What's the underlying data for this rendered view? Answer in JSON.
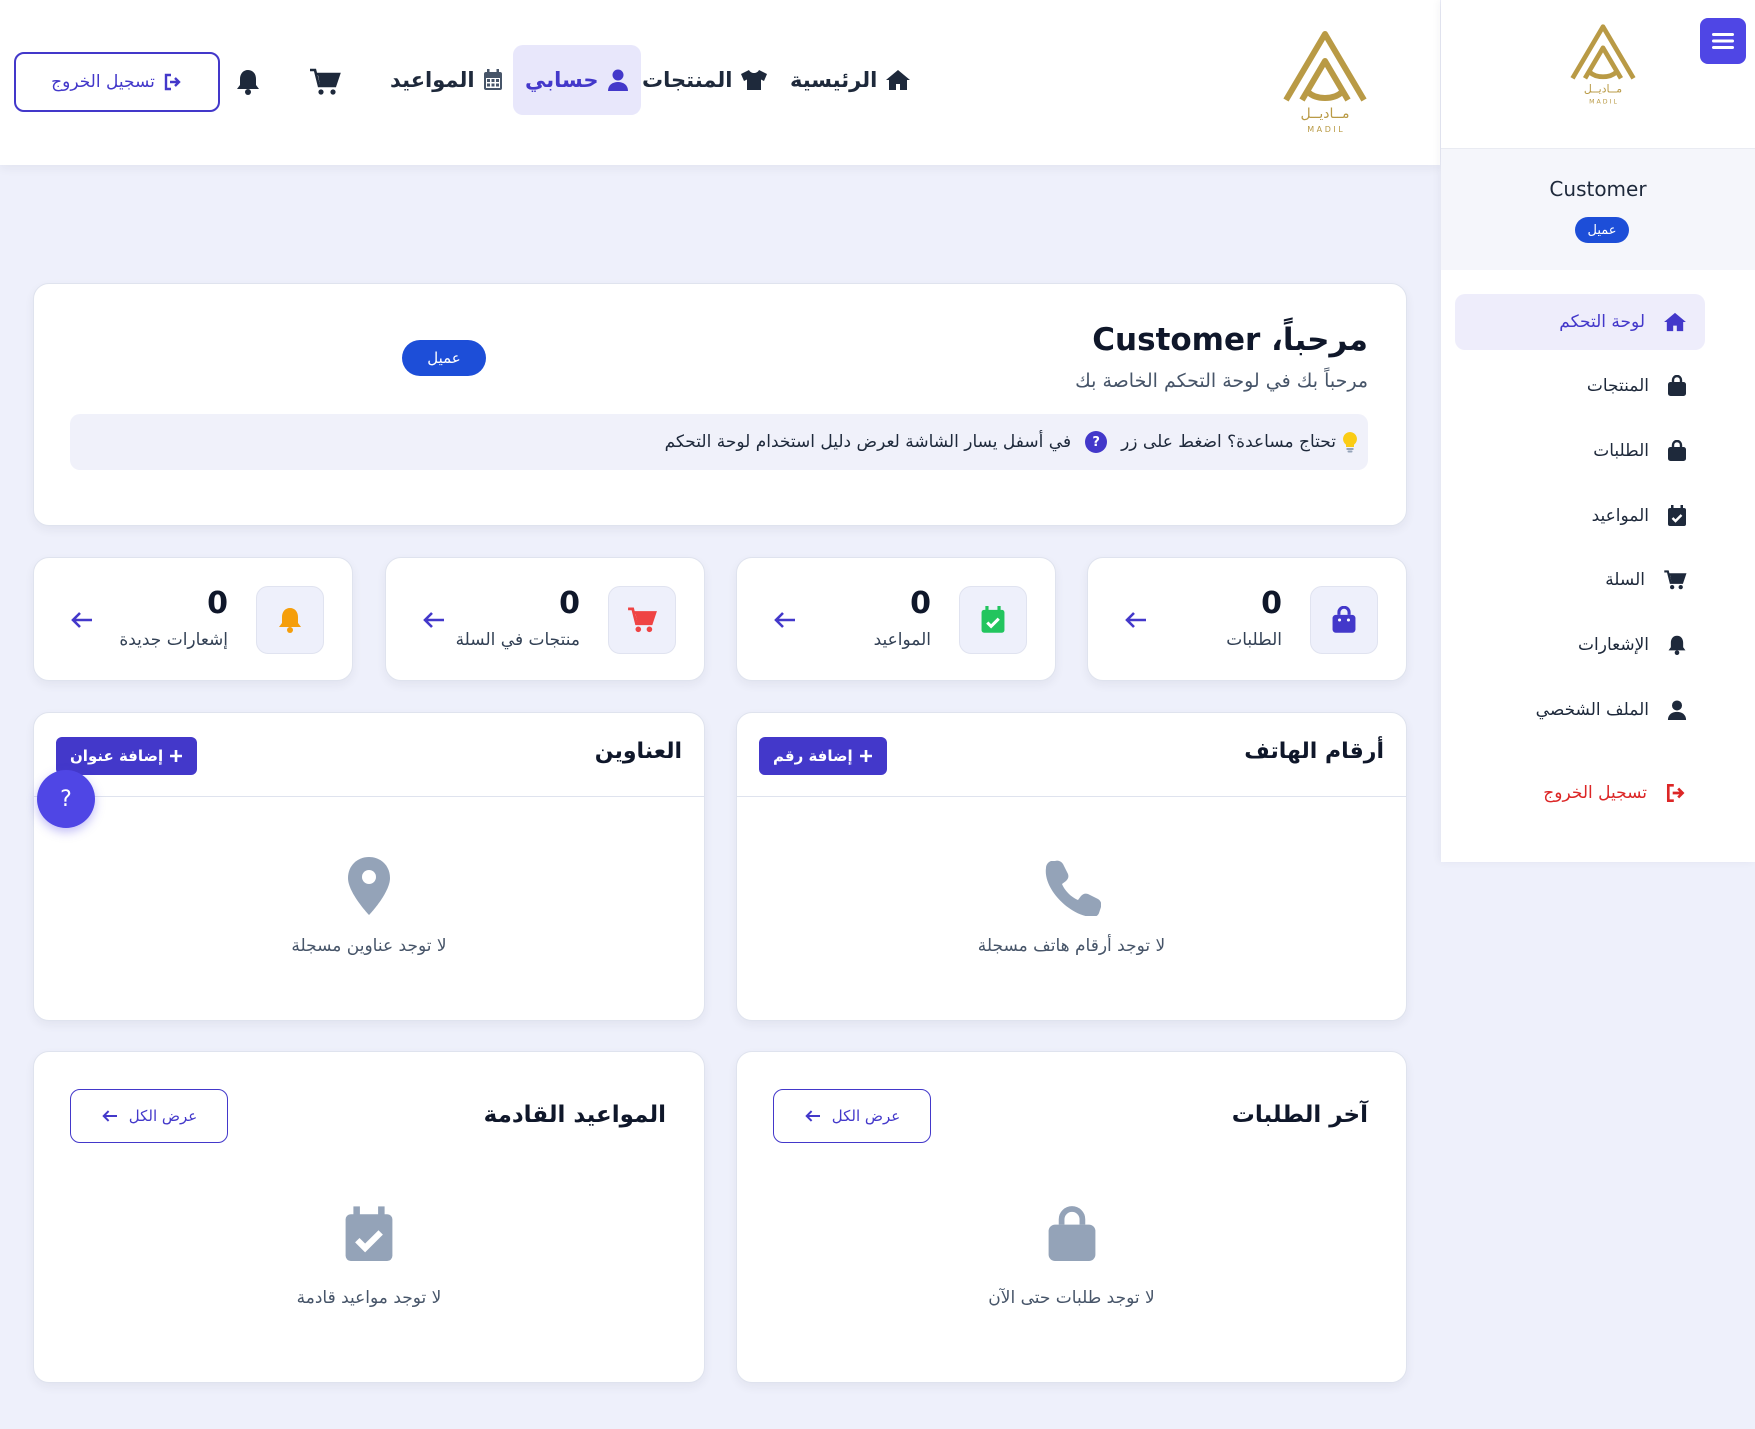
{
  "colors": {
    "accent": "#4338ca",
    "badge": "#1d4ed8",
    "logo_gold": "#b99a45",
    "danger": "#dc2626"
  },
  "topbar": {
    "logout_label": "تسجيل الخروج",
    "nav": [
      {
        "label": "الرئيسية",
        "icon": "home-icon"
      },
      {
        "label": "المنتجات",
        "icon": "shirt-icon"
      },
      {
        "label": "حسابي",
        "icon": "user-icon",
        "active": true
      },
      {
        "label": "المواعيد",
        "icon": "calendar-icon"
      }
    ],
    "logo_text": "مــاديــل",
    "logo_sub": "M A D I L"
  },
  "sidebar": {
    "user_name": "Customer",
    "user_role": "عميل",
    "items": [
      {
        "label": "لوحة التحكم",
        "icon": "home-icon",
        "active": true
      },
      {
        "label": "المنتجات",
        "icon": "bag-icon"
      },
      {
        "label": "الطلبات",
        "icon": "bag-icon"
      },
      {
        "label": "المواعيد",
        "icon": "calendar-check-icon"
      },
      {
        "label": "السلة",
        "icon": "cart-icon"
      },
      {
        "label": "الإشعارات",
        "icon": "bell-icon"
      },
      {
        "label": "الملف الشخصي",
        "icon": "user-icon"
      },
      {
        "label": "تسجيل الخروج",
        "icon": "logout-icon"
      }
    ]
  },
  "welcome": {
    "title": "مرحباً، Customer",
    "subtitle": "مرحباً بك في لوحة التحكم الخاصة بك",
    "badge": "عميل",
    "help_before": "تحتاج مساعدة؟ اضغط على زر",
    "help_after": "في أسفل يسار الشاشة لعرض دليل استخدام لوحة التحكم",
    "help_q": "?"
  },
  "stats": [
    {
      "value": "0",
      "label": "الطلبات",
      "icon": "bag-icon",
      "color": "#4338ca"
    },
    {
      "value": "0",
      "label": "المواعيد",
      "icon": "calendar-check-icon",
      "color": "#22c55e"
    },
    {
      "value": "0",
      "label": "منتجات في السلة",
      "icon": "cart-icon",
      "color": "#ef4444"
    },
    {
      "value": "0",
      "label": "إشعارات جديدة",
      "icon": "bell-icon",
      "color": "#f59e0b"
    }
  ],
  "phones": {
    "title": "أرقام الهاتف",
    "add_label": "إضافة رقم",
    "empty": "لا توجد أرقام هاتف مسجلة"
  },
  "addresses": {
    "title": "العناوين",
    "add_label": "إضافة عنوان",
    "empty": "لا توجد عناوين مسجلة"
  },
  "orders": {
    "title": "آخر الطلبات",
    "view_all": "عرض الكل",
    "empty": "لا توجد طلبات حتى الآن"
  },
  "appointments": {
    "title": "المواعيد القادمة",
    "view_all": "عرض الكل",
    "empty": "لا توجد مواعيد قادمة"
  },
  "help_fab": "?"
}
